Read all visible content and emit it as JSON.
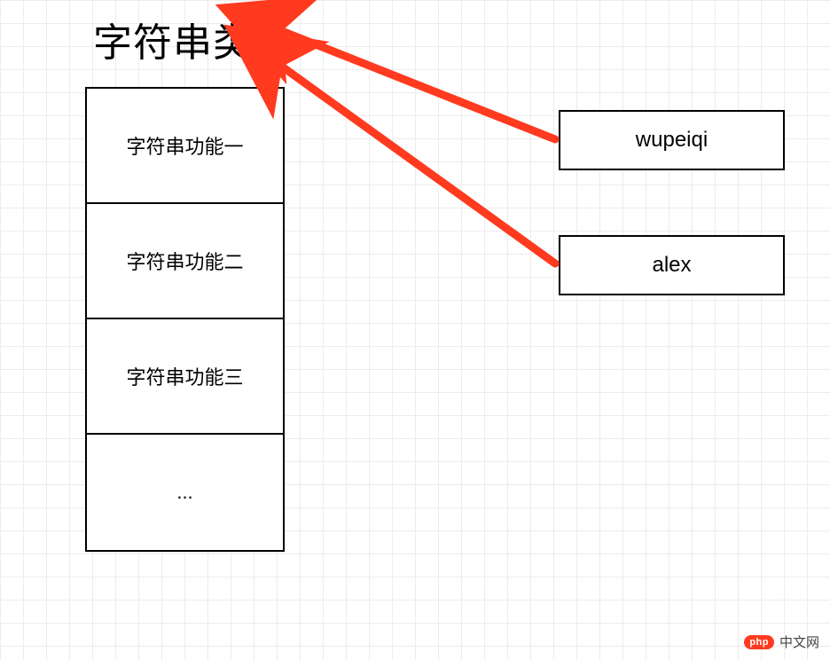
{
  "title": "字符串类",
  "class_box": {
    "items": [
      "字符串功能一",
      "字符串功能二",
      "字符串功能三",
      "..."
    ]
  },
  "objects": [
    {
      "label": "wupeiqi"
    },
    {
      "label": "alex"
    }
  ],
  "watermark": {
    "logo": "php",
    "text": "中文网"
  },
  "arrow_color": "#ff3a1f"
}
